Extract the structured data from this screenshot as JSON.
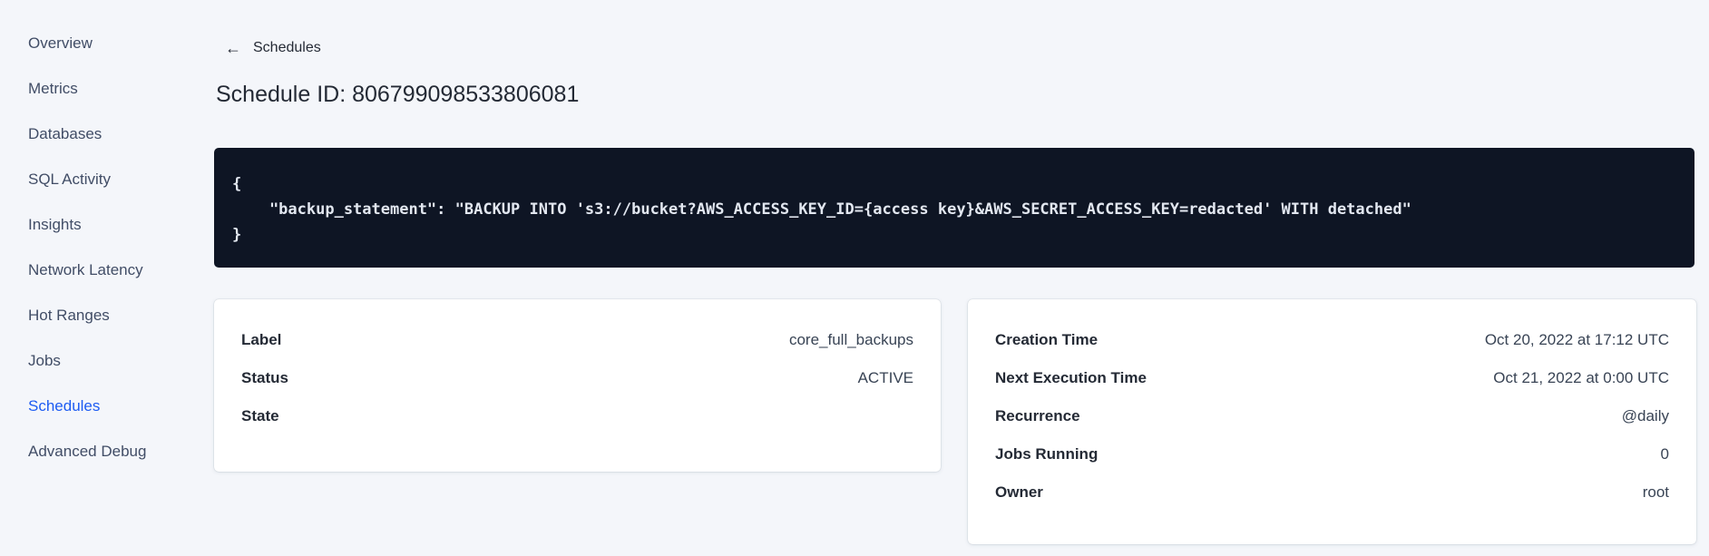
{
  "colors": {
    "page_background": "#f4f6fa",
    "accent_active_link": "#1d5cf2",
    "code_block_background": "#0e1524",
    "code_block_text": "#e2e7f0",
    "heading_text": "#242a35",
    "value_text": "#394455"
  },
  "sidebar": {
    "items": [
      {
        "label": "Overview",
        "active": false
      },
      {
        "label": "Metrics",
        "active": false
      },
      {
        "label": "Databases",
        "active": false
      },
      {
        "label": "SQL Activity",
        "active": false
      },
      {
        "label": "Insights",
        "active": false
      },
      {
        "label": "Network Latency",
        "active": false
      },
      {
        "label": "Hot Ranges",
        "active": false
      },
      {
        "label": "Jobs",
        "active": false
      },
      {
        "label": "Schedules",
        "active": true
      },
      {
        "label": "Advanced Debug",
        "active": false
      }
    ]
  },
  "header": {
    "back_icon": "left-arrow",
    "back_label": "Schedules",
    "title": "Schedule ID: 806799098533806081"
  },
  "code_block": {
    "lines": [
      "{",
      "    \"backup_statement\": \"BACKUP INTO 's3://bucket?AWS_ACCESS_KEY_ID={access key}&AWS_SECRET_ACCESS_KEY=redacted' WITH detached\"",
      "}"
    ]
  },
  "details_card": {
    "rows": [
      {
        "label": "Label",
        "value": "core_full_backups"
      },
      {
        "label": "Status",
        "value": "ACTIVE"
      },
      {
        "label": "State",
        "value": ""
      }
    ]
  },
  "schedule_card": {
    "rows": [
      {
        "label": "Creation Time",
        "value": "Oct 20, 2022 at 17:12 UTC"
      },
      {
        "label": "Next Execution Time",
        "value": "Oct 21, 2022 at 0:00 UTC"
      },
      {
        "label": "Recurrence",
        "value": "@daily"
      },
      {
        "label": "Jobs Running",
        "value": "0"
      },
      {
        "label": "Owner",
        "value": "root"
      }
    ]
  }
}
